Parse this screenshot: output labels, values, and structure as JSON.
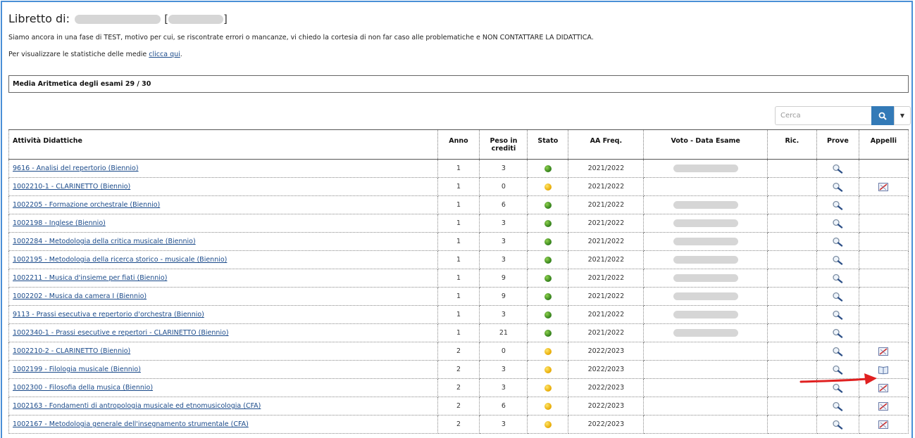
{
  "header": {
    "title_prefix": "Libretto di:",
    "notice": "Siamo ancora in una fase di TEST, motivo per cui, se riscontrate errori o mancanze, vi chiedo la cortesia di non far caso alle problematiche e NON CONTATTARE LA DIDATTICA.",
    "stats_text_prefix": "Per visualizzare le statistiche delle medie ",
    "stats_link": "clicca qui",
    "stats_text_suffix": "."
  },
  "media": {
    "label": "Media Aritmetica degli esami 29 / 30"
  },
  "search": {
    "placeholder": "Cerca"
  },
  "table": {
    "columns": [
      "Attività Didattiche",
      "Anno",
      "Peso in crediti",
      "Stato",
      "AA Freq.",
      "Voto - Data Esame",
      "Ric.",
      "Prove",
      "Appelli"
    ],
    "rows": [
      {
        "name": "9616 - Analisi del repertorio (Biennio)",
        "anno": "1",
        "crediti": "3",
        "stato": "green",
        "aa": "2021/2022",
        "voto_redacted": true,
        "appelli": ""
      },
      {
        "name": "1002210-1 - CLARINETTO (Biennio)",
        "anno": "1",
        "crediti": "0",
        "stato": "yellow",
        "aa": "2021/2022",
        "voto_redacted": false,
        "appelli": "no-appelli-icon"
      },
      {
        "name": "1002205 - Formazione orchestrale (Biennio)",
        "anno": "1",
        "crediti": "6",
        "stato": "green",
        "aa": "2021/2022",
        "voto_redacted": true,
        "appelli": ""
      },
      {
        "name": "1002198 - Inglese (Biennio)",
        "anno": "1",
        "crediti": "3",
        "stato": "green",
        "aa": "2021/2022",
        "voto_redacted": true,
        "appelli": ""
      },
      {
        "name": "1002284 - Metodologia della critica musicale (Biennio)",
        "anno": "1",
        "crediti": "3",
        "stato": "green",
        "aa": "2021/2022",
        "voto_redacted": true,
        "appelli": ""
      },
      {
        "name": "1002195 - Metodologia della ricerca storico - musicale (Biennio)",
        "anno": "1",
        "crediti": "3",
        "stato": "green",
        "aa": "2021/2022",
        "voto_redacted": true,
        "appelli": ""
      },
      {
        "name": "1002211 - Musica d'insieme per fiati (Biennio)",
        "anno": "1",
        "crediti": "9",
        "stato": "green",
        "aa": "2021/2022",
        "voto_redacted": true,
        "appelli": ""
      },
      {
        "name": "1002202 - Musica da camera I (Biennio)",
        "anno": "1",
        "crediti": "9",
        "stato": "green",
        "aa": "2021/2022",
        "voto_redacted": true,
        "appelli": ""
      },
      {
        "name": "9113 - Prassi esecutiva e repertorio d'orchestra (Biennio)",
        "anno": "1",
        "crediti": "3",
        "stato": "green",
        "aa": "2021/2022",
        "voto_redacted": true,
        "appelli": ""
      },
      {
        "name": "1002340-1 - Prassi esecutive e repertori - CLARINETTO (Biennio)",
        "anno": "1",
        "crediti": "21",
        "stato": "green",
        "aa": "2021/2022",
        "voto_redacted": true,
        "appelli": ""
      },
      {
        "name": "1002210-2 - CLARINETTO (Biennio)",
        "anno": "2",
        "crediti": "0",
        "stato": "yellow",
        "aa": "2022/2023",
        "voto_redacted": false,
        "appelli": "no-appelli-icon"
      },
      {
        "name": "1002199 - Filologia musicale (Biennio)",
        "anno": "2",
        "crediti": "3",
        "stato": "yellow",
        "aa": "2022/2023",
        "voto_redacted": false,
        "appelli": "book-icon"
      },
      {
        "name": "1002300 - Filosofia della musica (Biennio)",
        "anno": "2",
        "crediti": "3",
        "stato": "yellow",
        "aa": "2022/2023",
        "voto_redacted": false,
        "appelli": "no-appelli-icon"
      },
      {
        "name": "1002163 - Fondamenti di antropologia musicale ed etnomusicologia (CFA)",
        "anno": "2",
        "crediti": "6",
        "stato": "yellow",
        "aa": "2022/2023",
        "voto_redacted": false,
        "appelli": "no-appelli-icon"
      },
      {
        "name": "1002167 - Metodologia generale dell'insegnamento strumentale (CFA)",
        "anno": "2",
        "crediti": "3",
        "stato": "yellow",
        "aa": "2022/2023",
        "voto_redacted": false,
        "appelli": "no-appelli-icon"
      }
    ]
  },
  "colors": {
    "frame": "#4a8fd6",
    "link": "#1a4a8a",
    "search_button": "#337ab7",
    "status_green": "#3a8f1f",
    "status_yellow": "#f2b800",
    "annotation_arrow": "#e02020"
  }
}
